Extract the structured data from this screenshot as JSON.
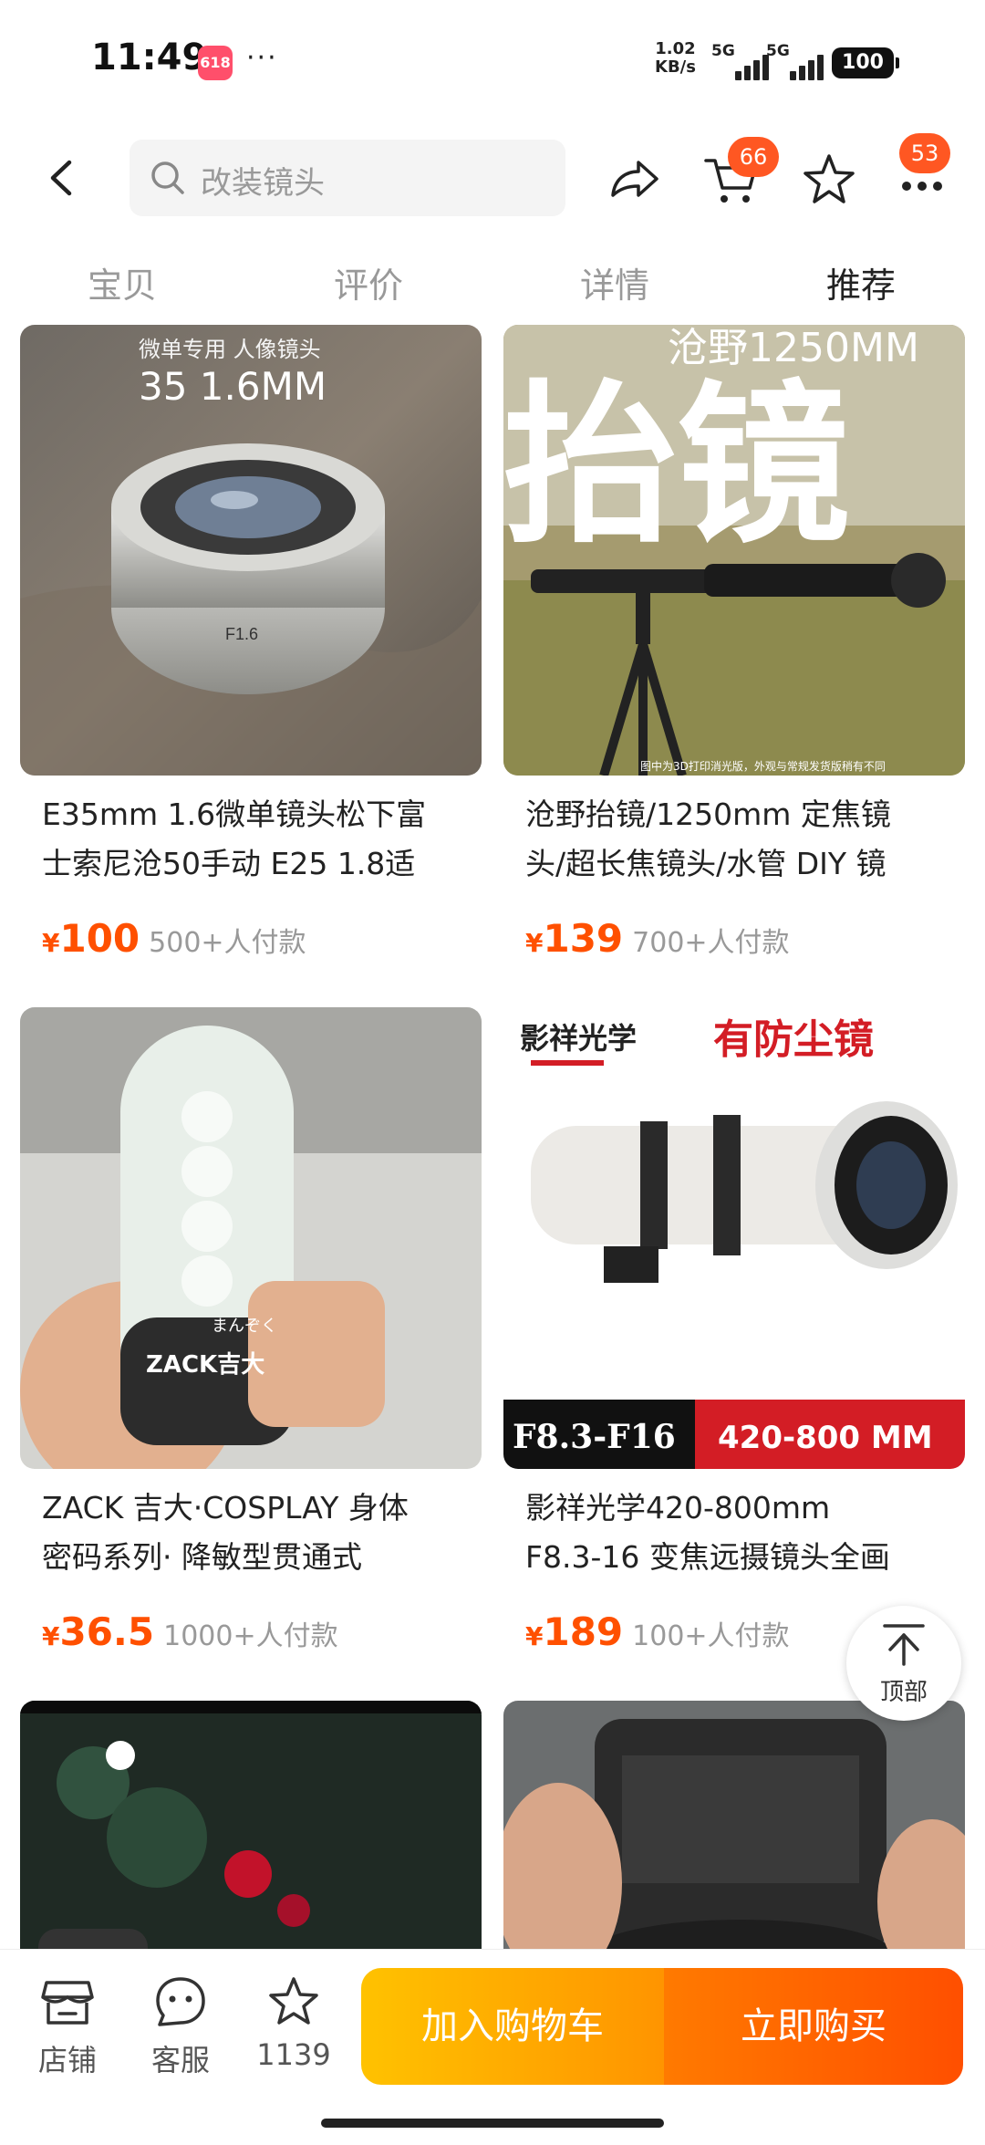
{
  "status": {
    "time": "11:49",
    "app_badge": "618",
    "dots": "···",
    "speed_value": "1.02",
    "speed_unit": "KB/s",
    "sim1": "5G",
    "sim2": "5G",
    "battery": "100"
  },
  "header": {
    "search_placeholder": "改装镜头",
    "cart_badge": "66",
    "more_badge": "53"
  },
  "tabs": [
    {
      "label": "宝贝",
      "active": false
    },
    {
      "label": "评价",
      "active": false
    },
    {
      "label": "详情",
      "active": false
    },
    {
      "label": "推荐",
      "active": true
    }
  ],
  "products": [
    {
      "image_caption_line1": "微单专用 人像镜头",
      "image_caption_line2": "35 1.6MM",
      "lens_marking": "F1.6",
      "title": "E35mm 1.6微单镜头松下富\n士索尼沧50手动 E25 1.8适",
      "currency": "¥",
      "price": "100",
      "sold": "500+人付款"
    },
    {
      "image_caption_line1": "沧野1250MM",
      "image_big_text": "抬镜",
      "image_footnote": "图中为3D打印消光版，外观与常规发货版稍有不同",
      "title": "沧野抬镜/1250mm 定焦镜\n头/超长焦镜头/水管 DIY 镜",
      "currency": "¥",
      "price": "139",
      "sold": "700+人付款"
    },
    {
      "image_brand": "ZACK吉大",
      "image_sticker": "まんぞく",
      "title": "ZACK 吉大·COSPLAY 身体\n密码系列· 降敏型贯通式",
      "currency": "¥",
      "price": "36.5",
      "sold": "1000+人付款"
    },
    {
      "image_brand": "影祥光学",
      "image_headline": "有防尘镜",
      "image_aperture": "F8.3-F16",
      "image_focal": "420-800 MM",
      "title": "影祥光学420-800mm\nF8.3-16 变焦远摄镜头全画",
      "currency": "¥",
      "price": "189",
      "sold": "100+人付款"
    }
  ],
  "back_to_top": "顶部",
  "bottom_bar": {
    "shop": "店铺",
    "service": "客服",
    "favorites": "1139",
    "add_to_cart": "加入购物车",
    "buy_now": "立即购买"
  },
  "colors": {
    "price": "#ff5000",
    "badge": "#ff5722",
    "cart_gradient": [
      "#ffc200",
      "#ff9400"
    ],
    "buy_gradient": [
      "#ff7a00",
      "#ff4f00"
    ]
  }
}
